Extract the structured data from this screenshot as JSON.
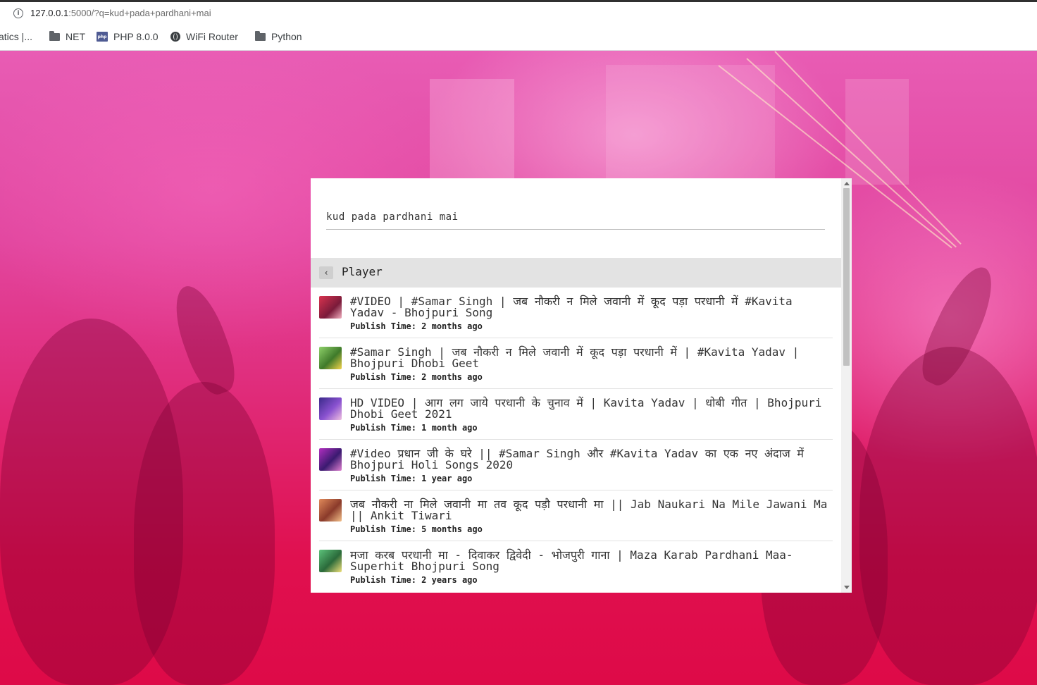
{
  "browser": {
    "url_host": "127.0.0.1",
    "url_rest": ":5000/?q=kud+pada+pardhani+mai",
    "bookmarks": [
      {
        "label": "atics |...",
        "icon": "none"
      },
      {
        "label": "NET",
        "icon": "folder-icon"
      },
      {
        "label": "PHP 8.0.0",
        "icon": "php-icon"
      },
      {
        "label": "WiFi Router",
        "icon": "globe-icon"
      },
      {
        "label": "Python",
        "icon": "folder-icon"
      }
    ]
  },
  "search": {
    "value": "kud pada pardhani mai"
  },
  "player": {
    "back_label": "‹",
    "title": "Player"
  },
  "results": [
    {
      "title": "#VIDEO | #Samar Singh | जब नौकरी न मिले जवानी में कूद पड़ा परधानी में #Kavita Yadav - Bhojpuri Song",
      "publish_label": "Publish Time:",
      "publish_value": "2 months ago",
      "thumb_color": "#b8234a"
    },
    {
      "title": "#Samar Singh | जब नौकरी न मिले जवानी में कूद पड़ा परधानी में | #Kavita Yadav | Bhojpuri Dhobi Geet",
      "publish_label": "Publish Time:",
      "publish_value": "2 months ago",
      "thumb_color": "#6aa84f"
    },
    {
      "title": "HD VIDEO | आग लग जाये परधानी के चुनाव में | Kavita Yadav | धोबी गीत | Bhojpuri Dhobi Geet 2021",
      "publish_label": "Publish Time:",
      "publish_value": "1 month ago",
      "thumb_color": "#5b3fa0"
    },
    {
      "title": "#Video प्रधान जी के घरे || #Samar Singh और #Kavita Yadav का एक नए अंदाज में Bhojpuri Holi Songs 2020",
      "publish_label": "Publish Time:",
      "publish_value": "1 year ago",
      "thumb_color": "#8e2a9e"
    },
    {
      "title": "जब नौकरी ना मिले जवानी मा तव कूद पड़ौ परधानी मा || Jab Naukari Na Mile Jawani Ma || Ankit Tiwari",
      "publish_label": "Publish Time:",
      "publish_value": "5 months ago",
      "thumb_color": "#c0603a"
    },
    {
      "title": "मजा करब परधानी मा - दिवाकर द्विवेदी - भोजपुरी गाना | Maza Karab Pardhani Maa-Superhit Bhojpuri Song",
      "publish_label": "Publish Time:",
      "publish_value": "2 years ago",
      "thumb_color": "#3f9a5a"
    }
  ]
}
